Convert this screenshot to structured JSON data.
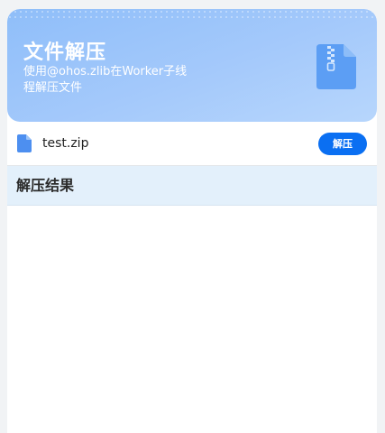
{
  "banner": {
    "title": "文件解压",
    "description": "使用@ohos.zlib在Worker子线程解压文件",
    "icon": "zip-file-icon"
  },
  "file_row": {
    "icon": "file-icon",
    "file_name": "test.zip",
    "button_label": "解压"
  },
  "result": {
    "title": "解压结果"
  },
  "colors": {
    "accent": "#0a6ff2",
    "banner": "#9cc6fa",
    "result_header": "#e3f0fb"
  }
}
